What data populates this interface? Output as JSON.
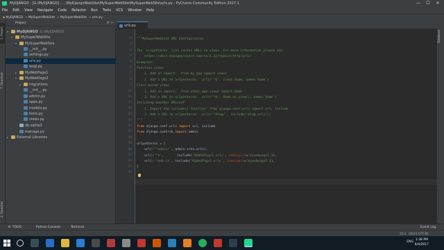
{
  "titlebar": {
    "title": "MyDJANGO - [G:\\MyDJANGO] - ...\\MyDjangoWebSite\\MySuperWebSite\\MySuperWebSite\\urls.py - PyCharm Community Edition 2017.1",
    "minimize": "—",
    "maximize": "☐",
    "close": "✕"
  },
  "menu": [
    "File",
    "Edit",
    "View",
    "Navigate",
    "Code",
    "Refactor",
    "Run",
    "Tools",
    "VCS",
    "Window",
    "Help"
  ],
  "breadcrumb": [
    "MyDJANGO",
    "MySuperWebSite",
    "MySuperWebSite",
    "urls.py"
  ],
  "left_tools": {
    "project": "1: Project",
    "structure": "7: Structure",
    "favorites": "2: Favorites"
  },
  "project_panel": {
    "header": "Project",
    "tree": [
      {
        "label": "MyDJANGO",
        "suffix": "G:\\MyDJANGO",
        "type": "folder",
        "arrow": "▾"
      },
      {
        "label": "MySuperWebSite",
        "suffix": "",
        "type": "folder",
        "arrow": "▾"
      },
      {
        "label": "MySuperWebSite",
        "suffix": "",
        "type": "folder",
        "arrow": "▾"
      },
      {
        "label": "__init__.py",
        "suffix": "",
        "type": "py",
        "arrow": ""
      },
      {
        "label": "settings.py",
        "suffix": "",
        "type": "py",
        "arrow": ""
      },
      {
        "label": "urls.py",
        "suffix": "",
        "type": "py",
        "arrow": "",
        "selected": true
      },
      {
        "label": "wsgi.py",
        "suffix": "",
        "type": "py",
        "arrow": ""
      },
      {
        "label": "MyWebPage1",
        "suffix": "",
        "type": "folder",
        "arrow": "▸"
      },
      {
        "label": "MyWebPage2",
        "suffix": "",
        "type": "folder",
        "arrow": "▾"
      },
      {
        "label": "migrations",
        "suffix": "",
        "type": "folder",
        "arrow": "▸"
      },
      {
        "label": "__init__.py",
        "suffix": "",
        "type": "py",
        "arrow": ""
      },
      {
        "label": "admin.py",
        "suffix": "",
        "type": "py",
        "arrow": ""
      },
      {
        "label": "apps.py",
        "suffix": "",
        "type": "py",
        "arrow": ""
      },
      {
        "label": "models.py",
        "suffix": "",
        "type": "py",
        "arrow": ""
      },
      {
        "label": "tests.py",
        "suffix": "",
        "type": "py",
        "arrow": ""
      },
      {
        "label": "views.py",
        "suffix": "",
        "type": "py",
        "arrow": ""
      },
      {
        "label": "db.sqlite3",
        "suffix": "",
        "type": "db",
        "arrow": ""
      },
      {
        "label": "manage.py",
        "suffix": "",
        "type": "py",
        "arrow": ""
      },
      {
        "label": "External Libraries",
        "suffix": "",
        "type": "folder",
        "arrow": "▸"
      }
    ]
  },
  "editor": {
    "tab": "urls.py",
    "line_numbers": [
      "1",
      "2",
      "3",
      "4",
      "5",
      "6",
      "7",
      "8",
      "9",
      "10",
      "11",
      "12",
      "13",
      "14",
      "15",
      "16",
      "17",
      "18",
      "19",
      "20",
      "21",
      "22",
      "23",
      "24"
    ]
  },
  "bottom_tools": {
    "todo": "6: TODO",
    "console": "Python Console",
    "terminal": "Terminal",
    "event_log": "Event Log"
  },
  "status": {
    "position": "23:1",
    "line_sep": "CRLF‡",
    "encoding": "UTF-8‡"
  },
  "taskbar": {
    "lang": "ENG",
    "time": "1:38 PM",
    "date": "6/4/2017"
  },
  "colors": {
    "accent": "#21d789",
    "selection": "#0d293e",
    "docstring": "#629755",
    "keyword": "#cc7832",
    "string": "#6a8759"
  }
}
